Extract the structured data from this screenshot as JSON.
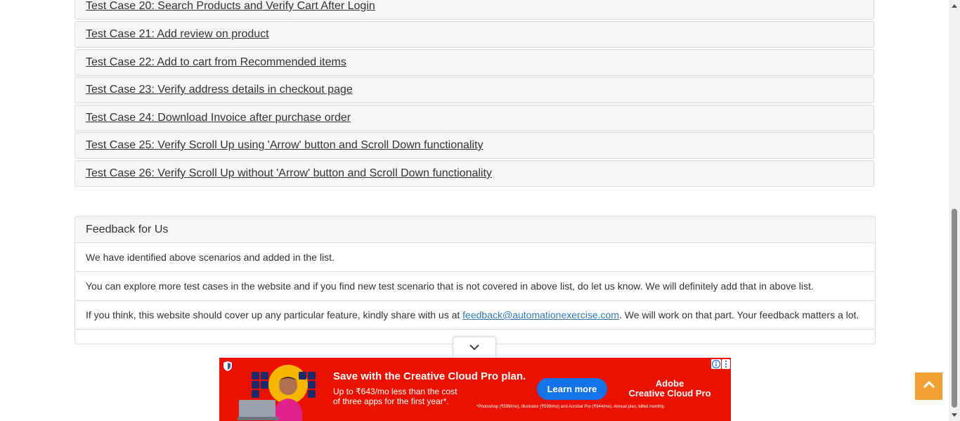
{
  "test_cases": [
    "Test Case 20: Search Products and Verify Cart After Login",
    "Test Case 21: Add review on product",
    "Test Case 22: Add to cart from Recommended items",
    "Test Case 23: Verify address details in checkout page",
    "Test Case 24: Download Invoice after purchase order",
    "Test Case 25: Verify Scroll Up using 'Arrow' button and Scroll Down functionality",
    "Test Case 26: Verify Scroll Up without 'Arrow' button and Scroll Down functionality"
  ],
  "feedback": {
    "title": "Feedback for Us",
    "line1": "We have identified above scenarios and added in the list.",
    "line2": "You can explore more test cases in the website and if you find new test scenario that is not covered in above list, do let us know. We will definitely add that in above list.",
    "line3_before": "If you think, this website should cover up any particular feature, kindly share with us at ",
    "email": "feedback@automationexercise.com",
    "line3_after": ". We will work on that part. Your feedback matters a lot."
  },
  "ad": {
    "headline": "Save with the Creative Cloud Pro plan.",
    "sub1": "Up to ₹643/mo less than the cost",
    "sub2": "of three apps for the first year*.",
    "button": "Learn more",
    "brand_line1": "Adobe",
    "brand_line2": "Creative Cloud Pro",
    "fine_print": "*Photoshop (₹599/mo), Illustrator (₹599/mo) and Acrobat Pro (₹944/mo). Annual plan, billed monthly.",
    "background_color": "#eb1000",
    "button_color": "#1473e6"
  },
  "icons": {
    "expand": "chevron-down-icon",
    "scroll_top": "chevron-up-icon",
    "ad_info": "info-icon",
    "ad_close": "close-icon",
    "ad_shield": "shield-icon"
  },
  "colors": {
    "scroll_top_button": "#f2a233",
    "link": "#337ab7",
    "panel_bg": "#f5f5f5"
  }
}
